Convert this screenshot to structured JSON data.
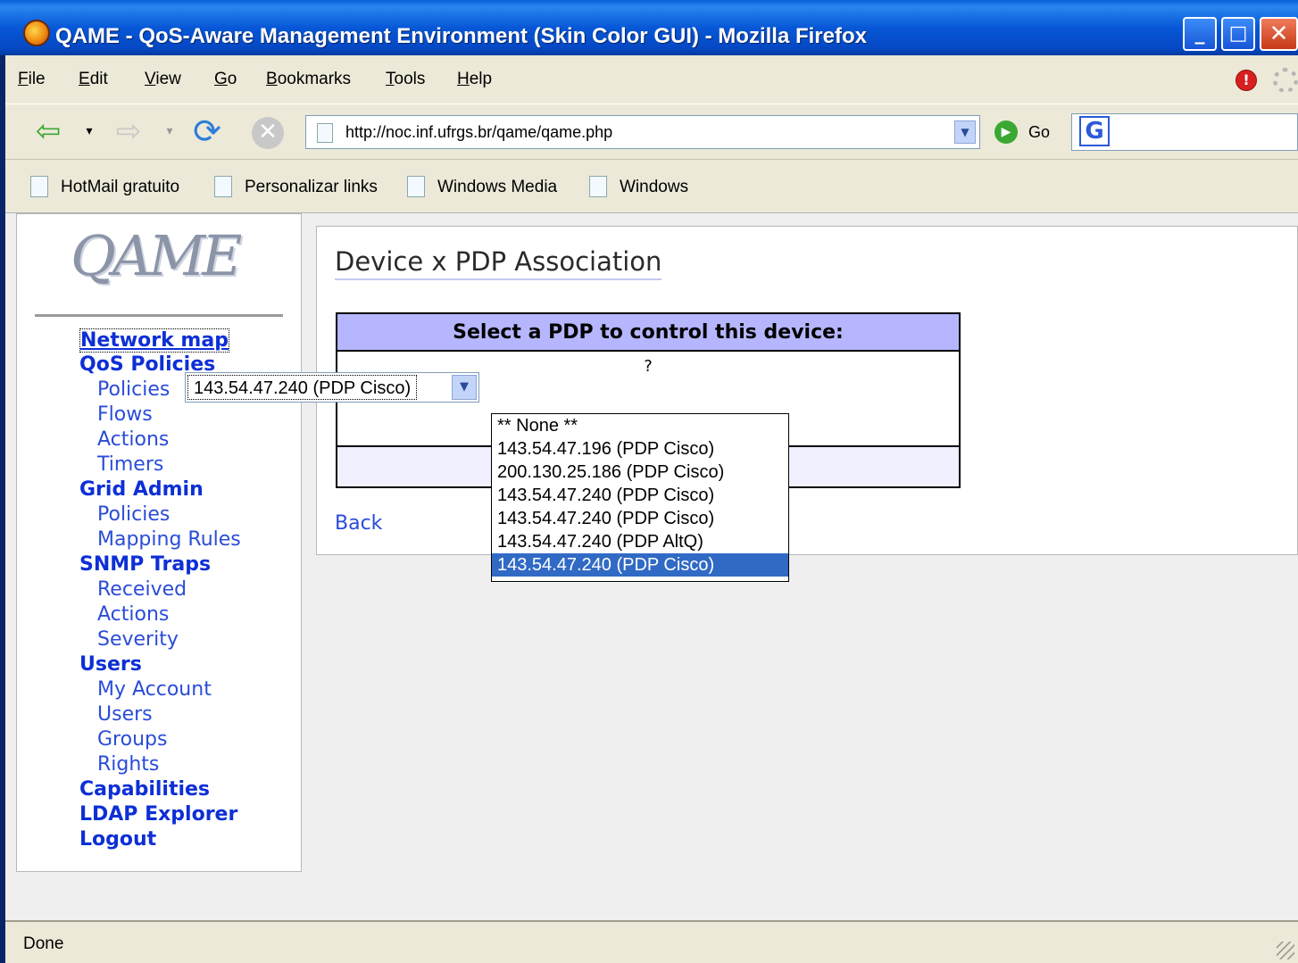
{
  "window": {
    "title": "QAME - QoS-Aware Management Environment (Skin Color GUI) - Mozilla Firefox",
    "minimize": "_",
    "maximize": "□",
    "close": "✕"
  },
  "menu": [
    {
      "key": "F",
      "rest": "ile"
    },
    {
      "key": "E",
      "rest": "dit"
    },
    {
      "key": "V",
      "rest": "iew"
    },
    {
      "key": "G",
      "rest": "o"
    },
    {
      "key": "B",
      "rest": "ookmarks"
    },
    {
      "key": "T",
      "rest": "ools"
    },
    {
      "key": "H",
      "rest": "elp"
    }
  ],
  "navigation": {
    "url": "http://noc.inf.ufrgs.br/qame/qame.php",
    "go_label": "Go"
  },
  "bookmarks": [
    "HotMail gratuito",
    "Personalizar links",
    "Windows Media",
    "Windows"
  ],
  "sidebar": {
    "logo": "QAME",
    "network_map": "Network map",
    "qos_policies": "QoS Policies",
    "qos_items": [
      "Policies",
      "Flows",
      "Actions",
      "Timers"
    ],
    "grid_admin": "Grid Admin",
    "grid_items": [
      "Policies",
      "Mapping Rules"
    ],
    "snmp_traps": "SNMP Traps",
    "snmp_items": [
      "Received",
      "Actions",
      "Severity"
    ],
    "users": "Users",
    "user_items": [
      "My Account",
      "Users",
      "Groups",
      "Rights"
    ],
    "capabilities": "Capabilities",
    "ldap_explorer": "LDAP Explorer",
    "logout": "Logout"
  },
  "main": {
    "title": "Device x PDP Association",
    "table_header": "Select a PDP to control this device:",
    "help": "?",
    "selected_pdp": "143.54.47.240 (PDP Cisco)",
    "options": [
      "** None **",
      "143.54.47.196 (PDP Cisco)",
      "200.130.25.186 (PDP Cisco)",
      "143.54.47.240 (PDP Cisco)",
      "143.54.47.240 (PDP Cisco)",
      "143.54.47.240 (PDP AltQ)",
      "143.54.47.240 (PDP Cisco)"
    ],
    "highlighted_option_index": 6,
    "back_link": "Back"
  },
  "status": "Done",
  "icons": {
    "title_logo": "firefox-logo-icon",
    "back": "back-arrow-icon",
    "forward": "forward-arrow-icon",
    "reload": "reload-icon",
    "stop": "stop-icon",
    "go": "go-icon",
    "search_engine": "google-icon"
  }
}
